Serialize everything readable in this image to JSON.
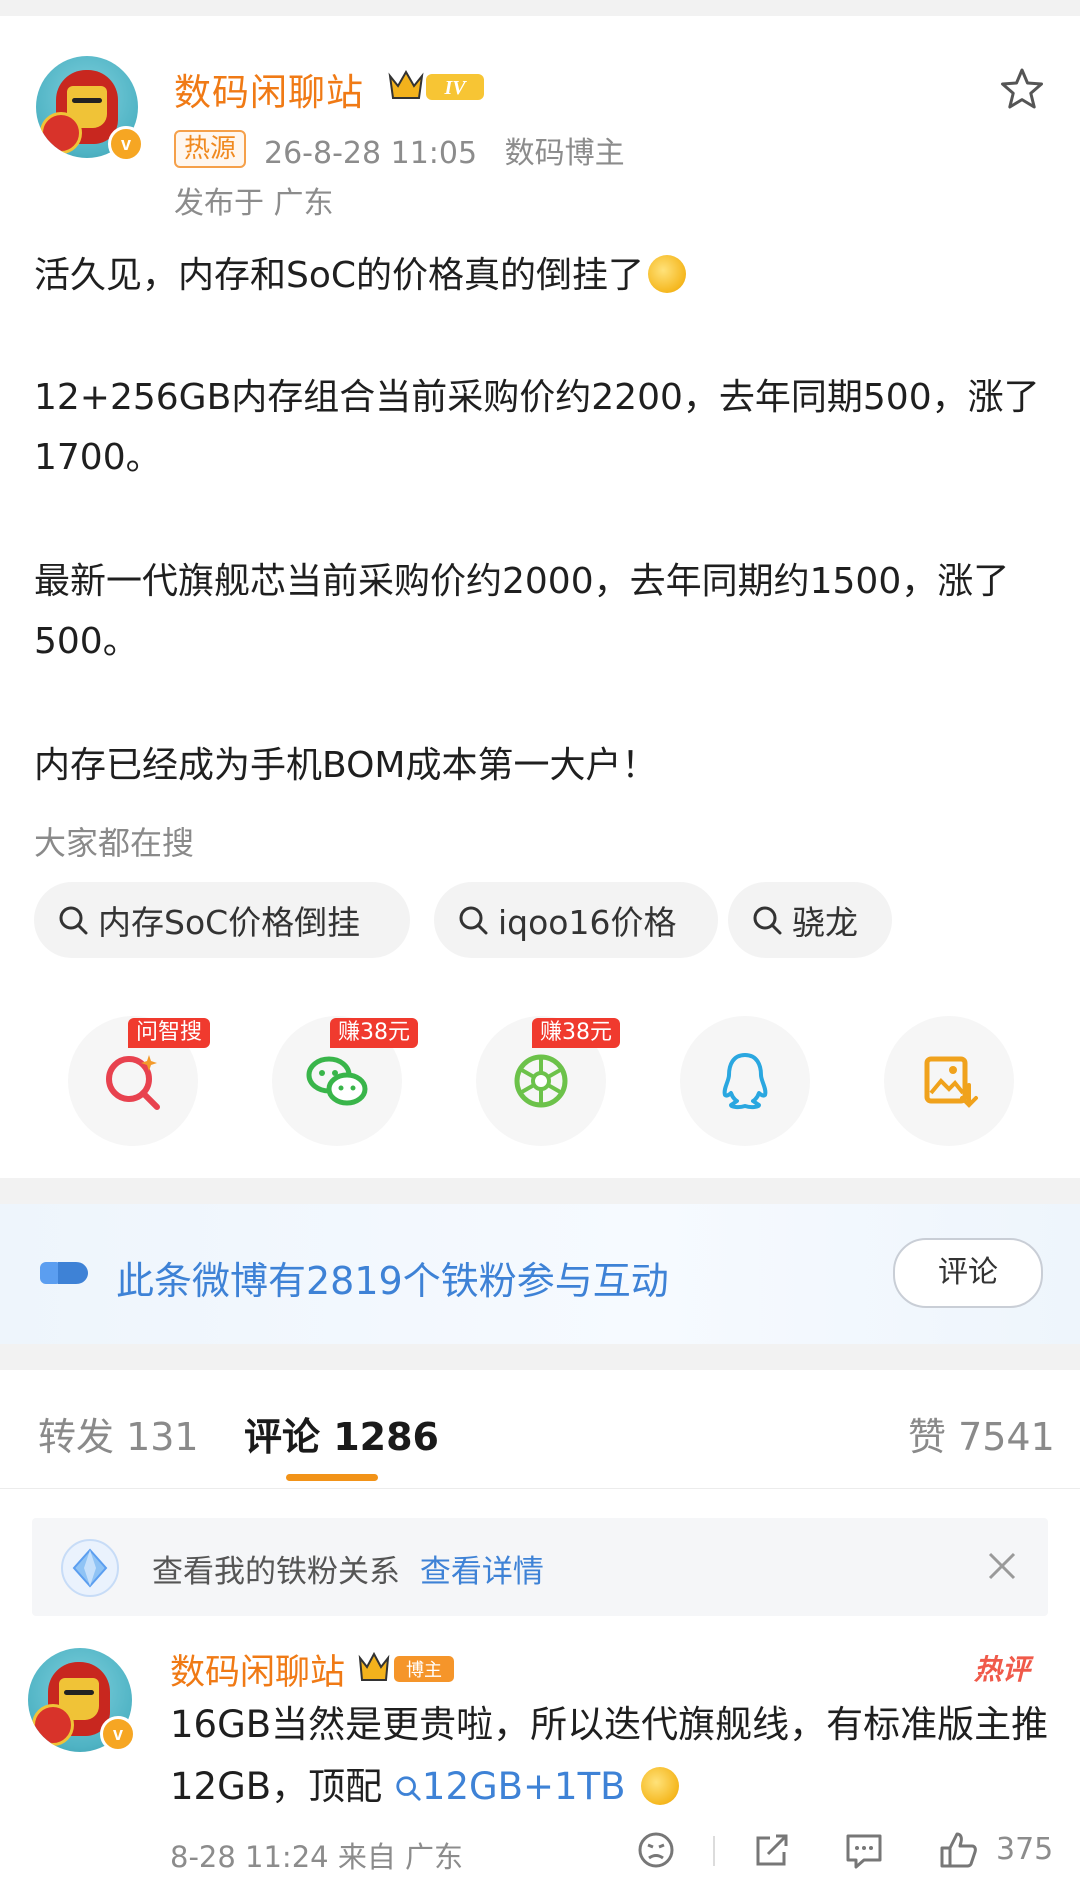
{
  "post": {
    "author": "数码闲聊站",
    "level_badge": "IV",
    "hot_tag": "热源",
    "datetime": "26-8-28 11:05",
    "author_role": "数码博主",
    "location": "发布于 广东",
    "paragraphs": [
      "活久见，内存和SoC的价格真的倒挂了",
      "12+256GB内存组合当前采购价约2200，去年同期500，涨了1700。",
      "最新一代旗舰芯当前采购价约2000，去年同期约1500，涨了500。",
      "内存已经成为手机BOM成本第一大户！"
    ]
  },
  "search": {
    "title": "大家都在搜",
    "chips": [
      "内存SoC价格倒挂",
      "iqoo16价格",
      "骁龙"
    ]
  },
  "share": {
    "badges": [
      "问智搜",
      "赚38元",
      "赚38元"
    ],
    "icons": [
      "ai-search-icon",
      "wechat-icon",
      "moments-icon",
      "qq-icon",
      "save-image-icon"
    ]
  },
  "fans": {
    "text": "此条微博有2819个铁粉参与互动",
    "button": "评论"
  },
  "tabs": {
    "repost": "转发 131",
    "comment": "评论 1286",
    "like": "赞 7541"
  },
  "relation": {
    "text": "查看我的铁粉关系",
    "link": "查看详情"
  },
  "comment": {
    "author": "数码闲聊站",
    "role_badge": "博主",
    "hot_label": "热评",
    "text": "16GB当然是更贵啦，所以迭代旗舰线，有标准版主推12GB，顶配",
    "link_text": "12GB+1TB",
    "meta": "8-28 11:24 来自 广东",
    "likes": "375"
  },
  "colors": {
    "accent_orange": "#f07a15",
    "link_blue": "#3e82d6",
    "tab_underline": "#f29318",
    "badge_red": "#f03a2e"
  }
}
